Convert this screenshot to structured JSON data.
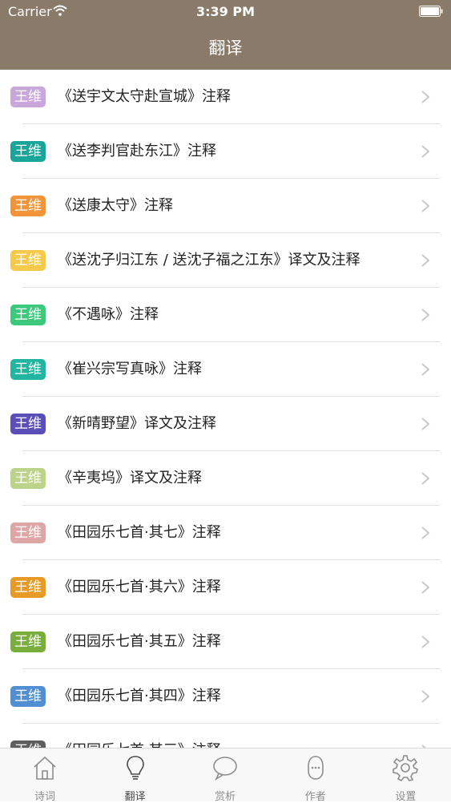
{
  "status_bar": {
    "carrier": "Carrier",
    "time": "3:39 PM"
  },
  "header": {
    "title": "翻译"
  },
  "rows": [
    {
      "badge": "王维",
      "color": "#c9a6dc",
      "title": "《送宇文太守赴宣城》注释"
    },
    {
      "badge": "王维",
      "color": "#1aa59a",
      "title": "《送李判官赴东江》注释"
    },
    {
      "badge": "王维",
      "color": "#f1943a",
      "title": "《送康太守》注释"
    },
    {
      "badge": "王维",
      "color": "#f6c94a",
      "title": "《送沈子归江东 / 送沈子福之江东》译文及注释"
    },
    {
      "badge": "王维",
      "color": "#3cc97c",
      "title": "《不遇咏》注释"
    },
    {
      "badge": "王维",
      "color": "#22b6a0",
      "title": "《崔兴宗写真咏》注释"
    },
    {
      "badge": "王维",
      "color": "#5a4fb8",
      "title": "《新晴野望》译文及注释"
    },
    {
      "badge": "王维",
      "color": "#bcd48a",
      "title": "《辛夷坞》译文及注释"
    },
    {
      "badge": "王维",
      "color": "#dfa6a6",
      "title": "《田园乐七首·其七》注释"
    },
    {
      "badge": "王维",
      "color": "#e89a26",
      "title": "《田园乐七首·其六》注释"
    },
    {
      "badge": "王维",
      "color": "#79ad3c",
      "title": "《田园乐七首·其五》注释"
    },
    {
      "badge": "王维",
      "color": "#4f8fd2",
      "title": "《田园乐七首·其四》注释"
    },
    {
      "badge": "王维",
      "color": "#5e5e5e",
      "title": "《田园乐七首·其三》注释"
    }
  ],
  "tabs": [
    {
      "id": "shici",
      "label": "诗词",
      "icon": "house-icon"
    },
    {
      "id": "fanyi",
      "label": "翻译",
      "icon": "lightbulb-icon",
      "active": true
    },
    {
      "id": "shangxi",
      "label": "赏析",
      "icon": "speech-bubble-icon"
    },
    {
      "id": "zuozhe",
      "label": "作者",
      "icon": "person-face-icon"
    },
    {
      "id": "shezhi",
      "label": "设置",
      "icon": "gear-icon"
    }
  ]
}
